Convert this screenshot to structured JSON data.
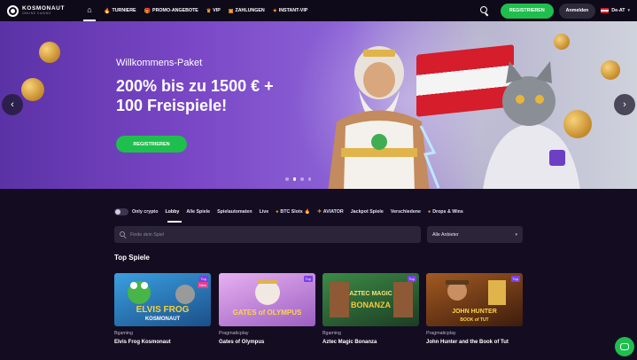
{
  "header": {
    "logo_main": "KOSMONAUT",
    "logo_sub": "ONLINE CASINO",
    "nav": [
      {
        "label": "TURNIERE",
        "icon": "trophy-icon",
        "glyph": "🔥"
      },
      {
        "label": "PROMO-ANGEBOTE",
        "icon": "gift-icon",
        "glyph": "🎁"
      },
      {
        "label": "VIP",
        "icon": "crown-icon",
        "glyph": "♛"
      },
      {
        "label": "ZAHLUNGEN",
        "icon": "wallet-icon",
        "glyph": "▣"
      },
      {
        "label": "INSTANT-VIP",
        "icon": "star-icon",
        "glyph": "✦"
      }
    ],
    "register_label": "REGISTRIEREN",
    "login_label": "Anmelden",
    "language": "De-AT"
  },
  "hero": {
    "title": "Willkommens-Paket",
    "offer": "200% bis zu 1500 € + 100 Freispiele!",
    "cta": "REGISTRIEREN",
    "prev_glyph": "‹",
    "next_glyph": "›",
    "slide_count": 4,
    "active_slide": 1
  },
  "filters": {
    "crypto_toggle_label": "Only crypto",
    "items": [
      {
        "label": "Lobby",
        "active": true
      },
      {
        "label": "Alle Spiele"
      },
      {
        "label": "Spielautomaten"
      },
      {
        "label": "Live"
      },
      {
        "label": "BTC Slots",
        "prefix": "●",
        "suffix": "🔥"
      },
      {
        "label": "AVIATOR",
        "prefix": "✈"
      },
      {
        "label": "Jackpot Spiele"
      },
      {
        "label": "Verschiedene"
      },
      {
        "label": "Drops & Wins",
        "prefix": "●"
      }
    ]
  },
  "search": {
    "placeholder": "Finde dein Spiel",
    "provider_select": "Alle Anbieter"
  },
  "section": {
    "title": "Top Spiele"
  },
  "games": [
    {
      "provider": "Bgaming",
      "name": "Elvis Frog Kosmonaut",
      "art_text": "ELVIS FROG",
      "art_sub": "KOSMONAUT",
      "badges": [
        "Top",
        "New"
      ],
      "bg": "#2a7bbd"
    },
    {
      "provider": "Pragmaticplay",
      "name": "Gates of Olympus",
      "art_text": "GATES of OLYMPUS",
      "art_sub": "",
      "badges": [
        "Top"
      ],
      "bg": "#c98bd8"
    },
    {
      "provider": "Bgaming",
      "name": "Aztec Magic Bonanza",
      "art_text": "AZTEC MAGIC",
      "art_sub": "BONANZA",
      "badges": [
        "Top"
      ],
      "bg": "#2c6b3a"
    },
    {
      "provider": "Pragmaticplay",
      "name": "John Hunter and the Book of Tut",
      "art_text": "JOHN HUNTER",
      "art_sub": "BOOK of TUT",
      "badges": [
        "Top"
      ],
      "bg": "#7a3f1a"
    }
  ],
  "colors": {
    "accent_green": "#1fbf4d",
    "background": "#140d22",
    "header_bg": "#0f0a1a",
    "badge_purple": "#7b3fe4"
  }
}
